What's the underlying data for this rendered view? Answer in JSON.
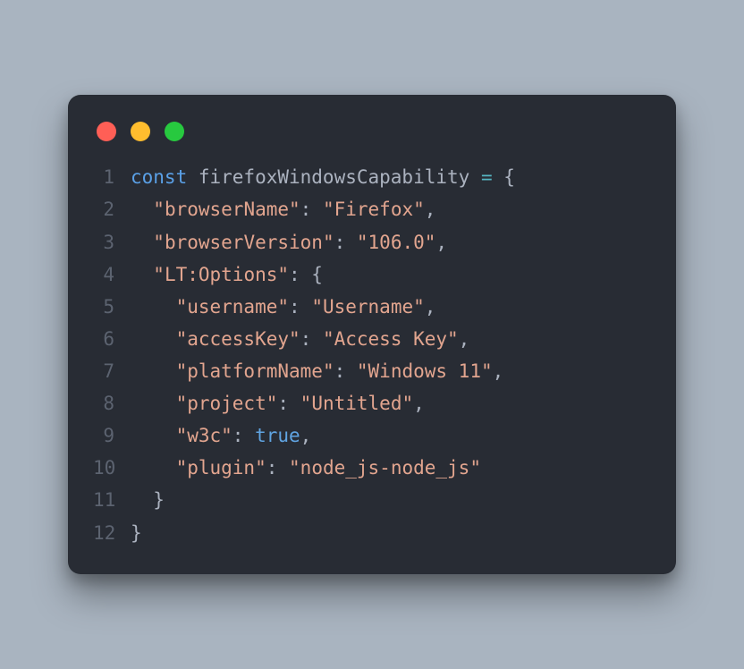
{
  "window": {
    "traffic_lights": {
      "red": "#ff5f56",
      "yellow": "#ffbd2e",
      "green": "#27c93f"
    }
  },
  "code": {
    "lines": [
      {
        "n": "1",
        "indent": "",
        "tokens": [
          {
            "cls": "tok-kw",
            "t": "const"
          },
          {
            "cls": "tok-id",
            "t": " firefoxWindowsCapability "
          },
          {
            "cls": "tok-op",
            "t": "="
          },
          {
            "cls": "tok-id",
            "t": " "
          },
          {
            "cls": "tok-pn",
            "t": "{"
          }
        ]
      },
      {
        "n": "2",
        "indent": "  ",
        "tokens": [
          {
            "cls": "tok-str",
            "t": "\"browserName\""
          },
          {
            "cls": "tok-pn",
            "t": ": "
          },
          {
            "cls": "tok-str",
            "t": "\"Firefox\""
          },
          {
            "cls": "tok-pn",
            "t": ","
          }
        ]
      },
      {
        "n": "3",
        "indent": "  ",
        "tokens": [
          {
            "cls": "tok-str",
            "t": "\"browserVersion\""
          },
          {
            "cls": "tok-pn",
            "t": ": "
          },
          {
            "cls": "tok-str",
            "t": "\"106.0\""
          },
          {
            "cls": "tok-pn",
            "t": ","
          }
        ]
      },
      {
        "n": "4",
        "indent": "  ",
        "tokens": [
          {
            "cls": "tok-str",
            "t": "\"LT:Options\""
          },
          {
            "cls": "tok-pn",
            "t": ": {"
          }
        ]
      },
      {
        "n": "5",
        "indent": "    ",
        "tokens": [
          {
            "cls": "tok-str",
            "t": "\"username\""
          },
          {
            "cls": "tok-pn",
            "t": ": "
          },
          {
            "cls": "tok-str",
            "t": "\"Username\""
          },
          {
            "cls": "tok-pn",
            "t": ","
          }
        ]
      },
      {
        "n": "6",
        "indent": "    ",
        "tokens": [
          {
            "cls": "tok-str",
            "t": "\"accessKey\""
          },
          {
            "cls": "tok-pn",
            "t": ": "
          },
          {
            "cls": "tok-str",
            "t": "\"Access Key\""
          },
          {
            "cls": "tok-pn",
            "t": ","
          }
        ]
      },
      {
        "n": "7",
        "indent": "    ",
        "tokens": [
          {
            "cls": "tok-str",
            "t": "\"platformName\""
          },
          {
            "cls": "tok-pn",
            "t": ": "
          },
          {
            "cls": "tok-str",
            "t": "\"Windows 11\""
          },
          {
            "cls": "tok-pn",
            "t": ","
          }
        ]
      },
      {
        "n": "8",
        "indent": "    ",
        "tokens": [
          {
            "cls": "tok-str",
            "t": "\"project\""
          },
          {
            "cls": "tok-pn",
            "t": ": "
          },
          {
            "cls": "tok-str",
            "t": "\"Untitled\""
          },
          {
            "cls": "tok-pn",
            "t": ","
          }
        ]
      },
      {
        "n": "9",
        "indent": "    ",
        "tokens": [
          {
            "cls": "tok-str",
            "t": "\"w3c\""
          },
          {
            "cls": "tok-pn",
            "t": ": "
          },
          {
            "cls": "tok-bool",
            "t": "true"
          },
          {
            "cls": "tok-pn",
            "t": ","
          }
        ]
      },
      {
        "n": "10",
        "indent": "    ",
        "tokens": [
          {
            "cls": "tok-str",
            "t": "\"plugin\""
          },
          {
            "cls": "tok-pn",
            "t": ": "
          },
          {
            "cls": "tok-str",
            "t": "\"node_js-node_js\""
          }
        ]
      },
      {
        "n": "11",
        "indent": "  ",
        "tokens": [
          {
            "cls": "tok-pn",
            "t": "}"
          }
        ]
      },
      {
        "n": "12",
        "indent": "",
        "tokens": [
          {
            "cls": "tok-pn",
            "t": "}"
          }
        ]
      }
    ]
  }
}
